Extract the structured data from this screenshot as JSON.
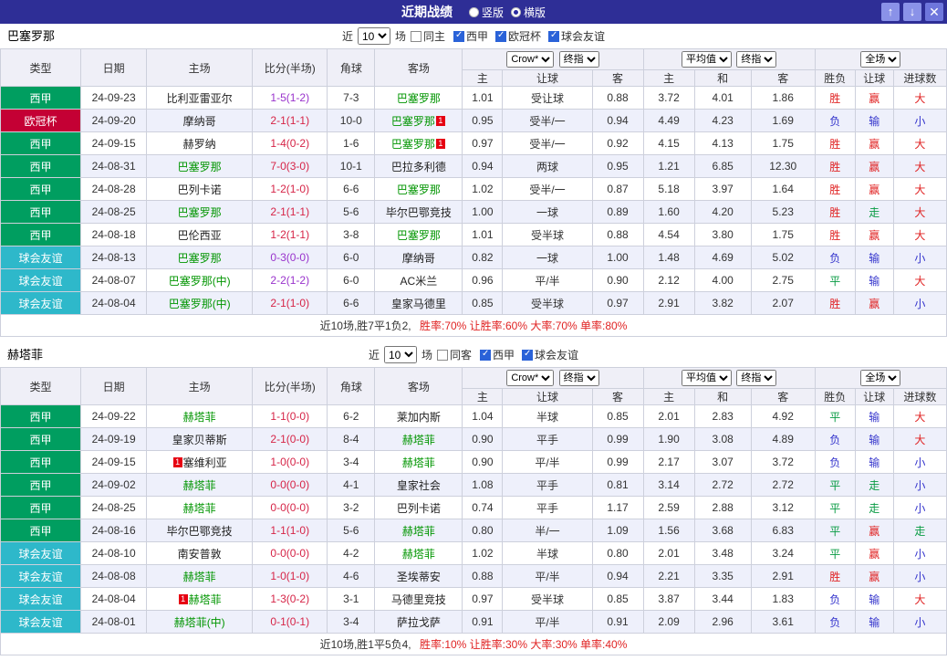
{
  "topbar": {
    "title": "近期战绩",
    "vertical_label": "竖版",
    "horizontal_label": "横版",
    "selected_layout": "横版",
    "up_icon": "↑",
    "down_icon": "↓",
    "close_icon": "✕"
  },
  "header": {
    "col_type": "类型",
    "col_date": "日期",
    "col_home": "主场",
    "col_score": "比分(半场)",
    "col_corner": "角球",
    "col_away": "客场",
    "bookmaker": "Crow*",
    "stage": "终指",
    "average": "平均值",
    "stage2": "终指",
    "scope": "全场",
    "sub": [
      "主",
      "让球",
      "客",
      "主",
      "和",
      "客",
      "胜负",
      "让球",
      "进球数"
    ]
  },
  "colors": {
    "topbar_bg": "#2e2e96",
    "team_highlight": "#009500",
    "league": {
      "西甲": "#009e60",
      "欧冠杯": "#c40034",
      "球会友谊": "#2eb8ca"
    },
    "score": {
      "red": "#d62447",
      "purple": "#9933cc"
    },
    "result": {
      "胜": "#e02222",
      "赢": "#e02222",
      "大": "#e02222",
      "负": "#3333cc",
      "输": "#3333cc",
      "小": "#3333cc",
      "平": "#089b43",
      "走": "#089b43"
    },
    "summary_red": "#e02222",
    "card_red": "#e60012"
  },
  "sections": [
    {
      "team": "巴塞罗那",
      "filter": {
        "near_label": "近",
        "count": "10",
        "games_label": "场",
        "same": {
          "label": "同主",
          "checked": false
        },
        "leagues": [
          {
            "label": "西甲",
            "checked": true
          },
          {
            "label": "欧冠杯",
            "checked": true
          },
          {
            "label": "球会友谊",
            "checked": true
          }
        ]
      },
      "rows": [
        {
          "type": "西甲",
          "date": "24-09-23",
          "home": "比利亚雷亚尔",
          "home_hl": false,
          "home_card": "",
          "score": "1-5(1-2)",
          "score_color": "purple",
          "corner": "7-3",
          "away": "巴塞罗那",
          "away_hl": true,
          "away_card": "",
          "odds": [
            "1.01",
            "受让球",
            "0.88"
          ],
          "avg": [
            "3.72",
            "4.01",
            "1.86"
          ],
          "results": [
            "胜",
            "赢",
            "大"
          ]
        },
        {
          "type": "欧冠杯",
          "date": "24-09-20",
          "home": "摩纳哥",
          "home_hl": false,
          "home_card": "",
          "score": "2-1(1-1)",
          "score_color": "red",
          "corner": "10-0",
          "away": "巴塞罗那",
          "away_hl": true,
          "away_card": "1",
          "odds": [
            "0.95",
            "受半/一",
            "0.94"
          ],
          "avg": [
            "4.49",
            "4.23",
            "1.69"
          ],
          "results": [
            "负",
            "输",
            "小"
          ]
        },
        {
          "type": "西甲",
          "date": "24-09-15",
          "home": "赫罗纳",
          "home_hl": false,
          "home_card": "",
          "score": "1-4(0-2)",
          "score_color": "red",
          "corner": "1-6",
          "away": "巴塞罗那",
          "away_hl": true,
          "away_card": "1",
          "odds": [
            "0.97",
            "受半/一",
            "0.92"
          ],
          "avg": [
            "4.15",
            "4.13",
            "1.75"
          ],
          "results": [
            "胜",
            "赢",
            "大"
          ]
        },
        {
          "type": "西甲",
          "date": "24-08-31",
          "home": "巴塞罗那",
          "home_hl": true,
          "home_card": "",
          "score": "7-0(3-0)",
          "score_color": "red",
          "corner": "10-1",
          "away": "巴拉多利德",
          "away_hl": false,
          "away_card": "",
          "odds": [
            "0.94",
            "两球",
            "0.95"
          ],
          "avg": [
            "1.21",
            "6.85",
            "12.30"
          ],
          "results": [
            "胜",
            "赢",
            "大"
          ]
        },
        {
          "type": "西甲",
          "date": "24-08-28",
          "home": "巴列卡诺",
          "home_hl": false,
          "home_card": "",
          "score": "1-2(1-0)",
          "score_color": "red",
          "corner": "6-6",
          "away": "巴塞罗那",
          "away_hl": true,
          "away_card": "",
          "odds": [
            "1.02",
            "受半/一",
            "0.87"
          ],
          "avg": [
            "5.18",
            "3.97",
            "1.64"
          ],
          "results": [
            "胜",
            "赢",
            "大"
          ]
        },
        {
          "type": "西甲",
          "date": "24-08-25",
          "home": "巴塞罗那",
          "home_hl": true,
          "home_card": "",
          "score": "2-1(1-1)",
          "score_color": "red",
          "corner": "5-6",
          "away": "毕尔巴鄂竞技",
          "away_hl": false,
          "away_card": "",
          "odds": [
            "1.00",
            "一球",
            "0.89"
          ],
          "avg": [
            "1.60",
            "4.20",
            "5.23"
          ],
          "results": [
            "胜",
            "走",
            "大"
          ]
        },
        {
          "type": "西甲",
          "date": "24-08-18",
          "home": "巴伦西亚",
          "home_hl": false,
          "home_card": "",
          "score": "1-2(1-1)",
          "score_color": "red",
          "corner": "3-8",
          "away": "巴塞罗那",
          "away_hl": true,
          "away_card": "",
          "odds": [
            "1.01",
            "受半球",
            "0.88"
          ],
          "avg": [
            "4.54",
            "3.80",
            "1.75"
          ],
          "results": [
            "胜",
            "赢",
            "大"
          ]
        },
        {
          "type": "球会友谊",
          "date": "24-08-13",
          "home": "巴塞罗那",
          "home_hl": true,
          "home_card": "",
          "score": "0-3(0-0)",
          "score_color": "purple",
          "corner": "6-0",
          "away": "摩纳哥",
          "away_hl": false,
          "away_card": "",
          "odds": [
            "0.82",
            "一球",
            "1.00"
          ],
          "avg": [
            "1.48",
            "4.69",
            "5.02"
          ],
          "results": [
            "负",
            "输",
            "小"
          ]
        },
        {
          "type": "球会友谊",
          "date": "24-08-07",
          "home": "巴塞罗那(中)",
          "home_hl": true,
          "home_card": "",
          "score": "2-2(1-2)",
          "score_color": "purple",
          "corner": "6-0",
          "away": "AC米兰",
          "away_hl": false,
          "away_card": "",
          "odds": [
            "0.96",
            "平/半",
            "0.90"
          ],
          "avg": [
            "2.12",
            "4.00",
            "2.75"
          ],
          "results": [
            "平",
            "输",
            "大"
          ]
        },
        {
          "type": "球会友谊",
          "date": "24-08-04",
          "home": "巴塞罗那(中)",
          "home_hl": true,
          "home_card": "",
          "score": "2-1(1-0)",
          "score_color": "red",
          "corner": "6-6",
          "away": "皇家马德里",
          "away_hl": false,
          "away_card": "",
          "odds": [
            "0.85",
            "受半球",
            "0.97"
          ],
          "avg": [
            "2.91",
            "3.82",
            "2.07"
          ],
          "results": [
            "胜",
            "赢",
            "小"
          ]
        }
      ],
      "summary_main": "近10场,胜7平1负2,",
      "summary_stats": "胜率:70% 让胜率:60% 大率:70% 单率:80%"
    },
    {
      "team": "赫塔菲",
      "filter": {
        "near_label": "近",
        "count": "10",
        "games_label": "场",
        "same": {
          "label": "同客",
          "checked": false
        },
        "leagues": [
          {
            "label": "西甲",
            "checked": true
          },
          {
            "label": "球会友谊",
            "checked": true
          }
        ]
      },
      "rows": [
        {
          "type": "西甲",
          "date": "24-09-22",
          "home": "赫塔菲",
          "home_hl": true,
          "home_card": "",
          "score": "1-1(0-0)",
          "score_color": "red",
          "corner": "6-2",
          "away": "莱加内斯",
          "away_hl": false,
          "away_card": "",
          "odds": [
            "1.04",
            "半球",
            "0.85"
          ],
          "avg": [
            "2.01",
            "2.83",
            "4.92"
          ],
          "results": [
            "平",
            "输",
            "大"
          ]
        },
        {
          "type": "西甲",
          "date": "24-09-19",
          "home": "皇家贝蒂斯",
          "home_hl": false,
          "home_card": "",
          "score": "2-1(0-0)",
          "score_color": "red",
          "corner": "8-4",
          "away": "赫塔菲",
          "away_hl": true,
          "away_card": "",
          "odds": [
            "0.90",
            "平手",
            "0.99"
          ],
          "avg": [
            "1.90",
            "3.08",
            "4.89"
          ],
          "results": [
            "负",
            "输",
            "大"
          ]
        },
        {
          "type": "西甲",
          "date": "24-09-15",
          "home": "塞维利亚",
          "home_hl": false,
          "home_card": "1",
          "score": "1-0(0-0)",
          "score_color": "red",
          "corner": "3-4",
          "away": "赫塔菲",
          "away_hl": true,
          "away_card": "",
          "odds": [
            "0.90",
            "平/半",
            "0.99"
          ],
          "avg": [
            "2.17",
            "3.07",
            "3.72"
          ],
          "results": [
            "负",
            "输",
            "小"
          ]
        },
        {
          "type": "西甲",
          "date": "24-09-02",
          "home": "赫塔菲",
          "home_hl": true,
          "home_card": "",
          "score": "0-0(0-0)",
          "score_color": "red",
          "corner": "4-1",
          "away": "皇家社会",
          "away_hl": false,
          "away_card": "",
          "odds": [
            "1.08",
            "平手",
            "0.81"
          ],
          "avg": [
            "3.14",
            "2.72",
            "2.72"
          ],
          "results": [
            "平",
            "走",
            "小"
          ]
        },
        {
          "type": "西甲",
          "date": "24-08-25",
          "home": "赫塔菲",
          "home_hl": true,
          "home_card": "",
          "score": "0-0(0-0)",
          "score_color": "red",
          "corner": "3-2",
          "away": "巴列卡诺",
          "away_hl": false,
          "away_card": "",
          "odds": [
            "0.74",
            "平手",
            "1.17"
          ],
          "avg": [
            "2.59",
            "2.88",
            "3.12"
          ],
          "results": [
            "平",
            "走",
            "小"
          ]
        },
        {
          "type": "西甲",
          "date": "24-08-16",
          "home": "毕尔巴鄂竞技",
          "home_hl": false,
          "home_card": "",
          "score": "1-1(1-0)",
          "score_color": "red",
          "corner": "5-6",
          "away": "赫塔菲",
          "away_hl": true,
          "away_card": "",
          "odds": [
            "0.80",
            "半/一",
            "1.09"
          ],
          "avg": [
            "1.56",
            "3.68",
            "6.83"
          ],
          "results": [
            "平",
            "赢",
            "走"
          ]
        },
        {
          "type": "球会友谊",
          "date": "24-08-10",
          "home": "南安普敦",
          "home_hl": false,
          "home_card": "",
          "score": "0-0(0-0)",
          "score_color": "red",
          "corner": "4-2",
          "away": "赫塔菲",
          "away_hl": true,
          "away_card": "",
          "odds": [
            "1.02",
            "半球",
            "0.80"
          ],
          "avg": [
            "2.01",
            "3.48",
            "3.24"
          ],
          "results": [
            "平",
            "赢",
            "小"
          ]
        },
        {
          "type": "球会友谊",
          "date": "24-08-08",
          "home": "赫塔菲",
          "home_hl": true,
          "home_card": "",
          "score": "1-0(1-0)",
          "score_color": "red",
          "corner": "4-6",
          "away": "圣埃蒂安",
          "away_hl": false,
          "away_card": "",
          "odds": [
            "0.88",
            "平/半",
            "0.94"
          ],
          "avg": [
            "2.21",
            "3.35",
            "2.91"
          ],
          "results": [
            "胜",
            "赢",
            "小"
          ]
        },
        {
          "type": "球会友谊",
          "date": "24-08-04",
          "home": "赫塔菲",
          "home_hl": true,
          "home_card": "1",
          "score": "1-3(0-2)",
          "score_color": "red",
          "corner": "3-1",
          "away": "马德里竞技",
          "away_hl": false,
          "away_card": "",
          "odds": [
            "0.97",
            "受半球",
            "0.85"
          ],
          "avg": [
            "3.87",
            "3.44",
            "1.83"
          ],
          "results": [
            "负",
            "输",
            "大"
          ]
        },
        {
          "type": "球会友谊",
          "date": "24-08-01",
          "home": "赫塔菲(中)",
          "home_hl": true,
          "home_card": "",
          "score": "0-1(0-1)",
          "score_color": "red",
          "corner": "3-4",
          "away": "萨拉戈萨",
          "away_hl": false,
          "away_card": "",
          "odds": [
            "0.91",
            "平/半",
            "0.91"
          ],
          "avg": [
            "2.09",
            "2.96",
            "3.61"
          ],
          "results": [
            "负",
            "输",
            "小"
          ]
        }
      ],
      "summary_main": "近10场,胜1平5负4,",
      "summary_stats": "胜率:10% 让胜率:30% 大率:30% 单率:40%"
    }
  ]
}
